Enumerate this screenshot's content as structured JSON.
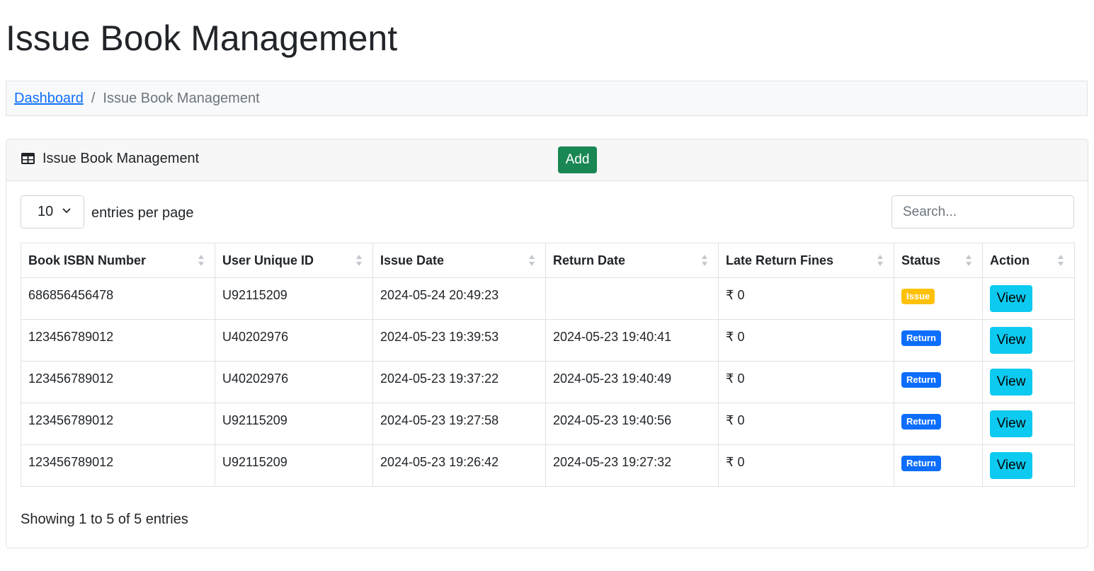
{
  "page": {
    "title": "Issue Book Management"
  },
  "breadcrumb": {
    "home": "Dashboard",
    "separator": "/",
    "current": "Issue Book Management"
  },
  "card": {
    "title": "Issue Book Management",
    "icon": "table-icon",
    "add_label": "Add"
  },
  "controls": {
    "entries_value": "10",
    "entries_label": "entries per page",
    "search_placeholder": "Search..."
  },
  "table": {
    "headers": [
      "Book ISBN Number",
      "User Unique ID",
      "Issue Date",
      "Return Date",
      "Late Return Fines",
      "Status",
      "Action"
    ],
    "rows": [
      {
        "isbn": "686856456478",
        "user": "U92115209",
        "issue_date": "2024-05-24 20:49:23",
        "return_date": "",
        "fine": "₹ 0",
        "status": "Issue",
        "status_type": "issue",
        "action": "View"
      },
      {
        "isbn": "123456789012",
        "user": "U40202976",
        "issue_date": "2024-05-23 19:39:53",
        "return_date": "2024-05-23 19:40:41",
        "fine": "₹ 0",
        "status": "Return",
        "status_type": "return",
        "action": "View"
      },
      {
        "isbn": "123456789012",
        "user": "U40202976",
        "issue_date": "2024-05-23 19:37:22",
        "return_date": "2024-05-23 19:40:49",
        "fine": "₹ 0",
        "status": "Return",
        "status_type": "return",
        "action": "View"
      },
      {
        "isbn": "123456789012",
        "user": "U92115209",
        "issue_date": "2024-05-23 19:27:58",
        "return_date": "2024-05-23 19:40:56",
        "fine": "₹ 0",
        "status": "Return",
        "status_type": "return",
        "action": "View"
      },
      {
        "isbn": "123456789012",
        "user": "U92115209",
        "issue_date": "2024-05-23 19:26:42",
        "return_date": "2024-05-23 19:27:32",
        "fine": "₹ 0",
        "status": "Return",
        "status_type": "return",
        "action": "View"
      }
    ]
  },
  "footer": {
    "info": "Showing 1 to 5 of 5 entries"
  },
  "colors": {
    "add_button": "#198754",
    "view_button": "#0dcaf0",
    "badge_issue": "#ffc107",
    "badge_return": "#0d6efd",
    "link": "#0d6efd"
  }
}
